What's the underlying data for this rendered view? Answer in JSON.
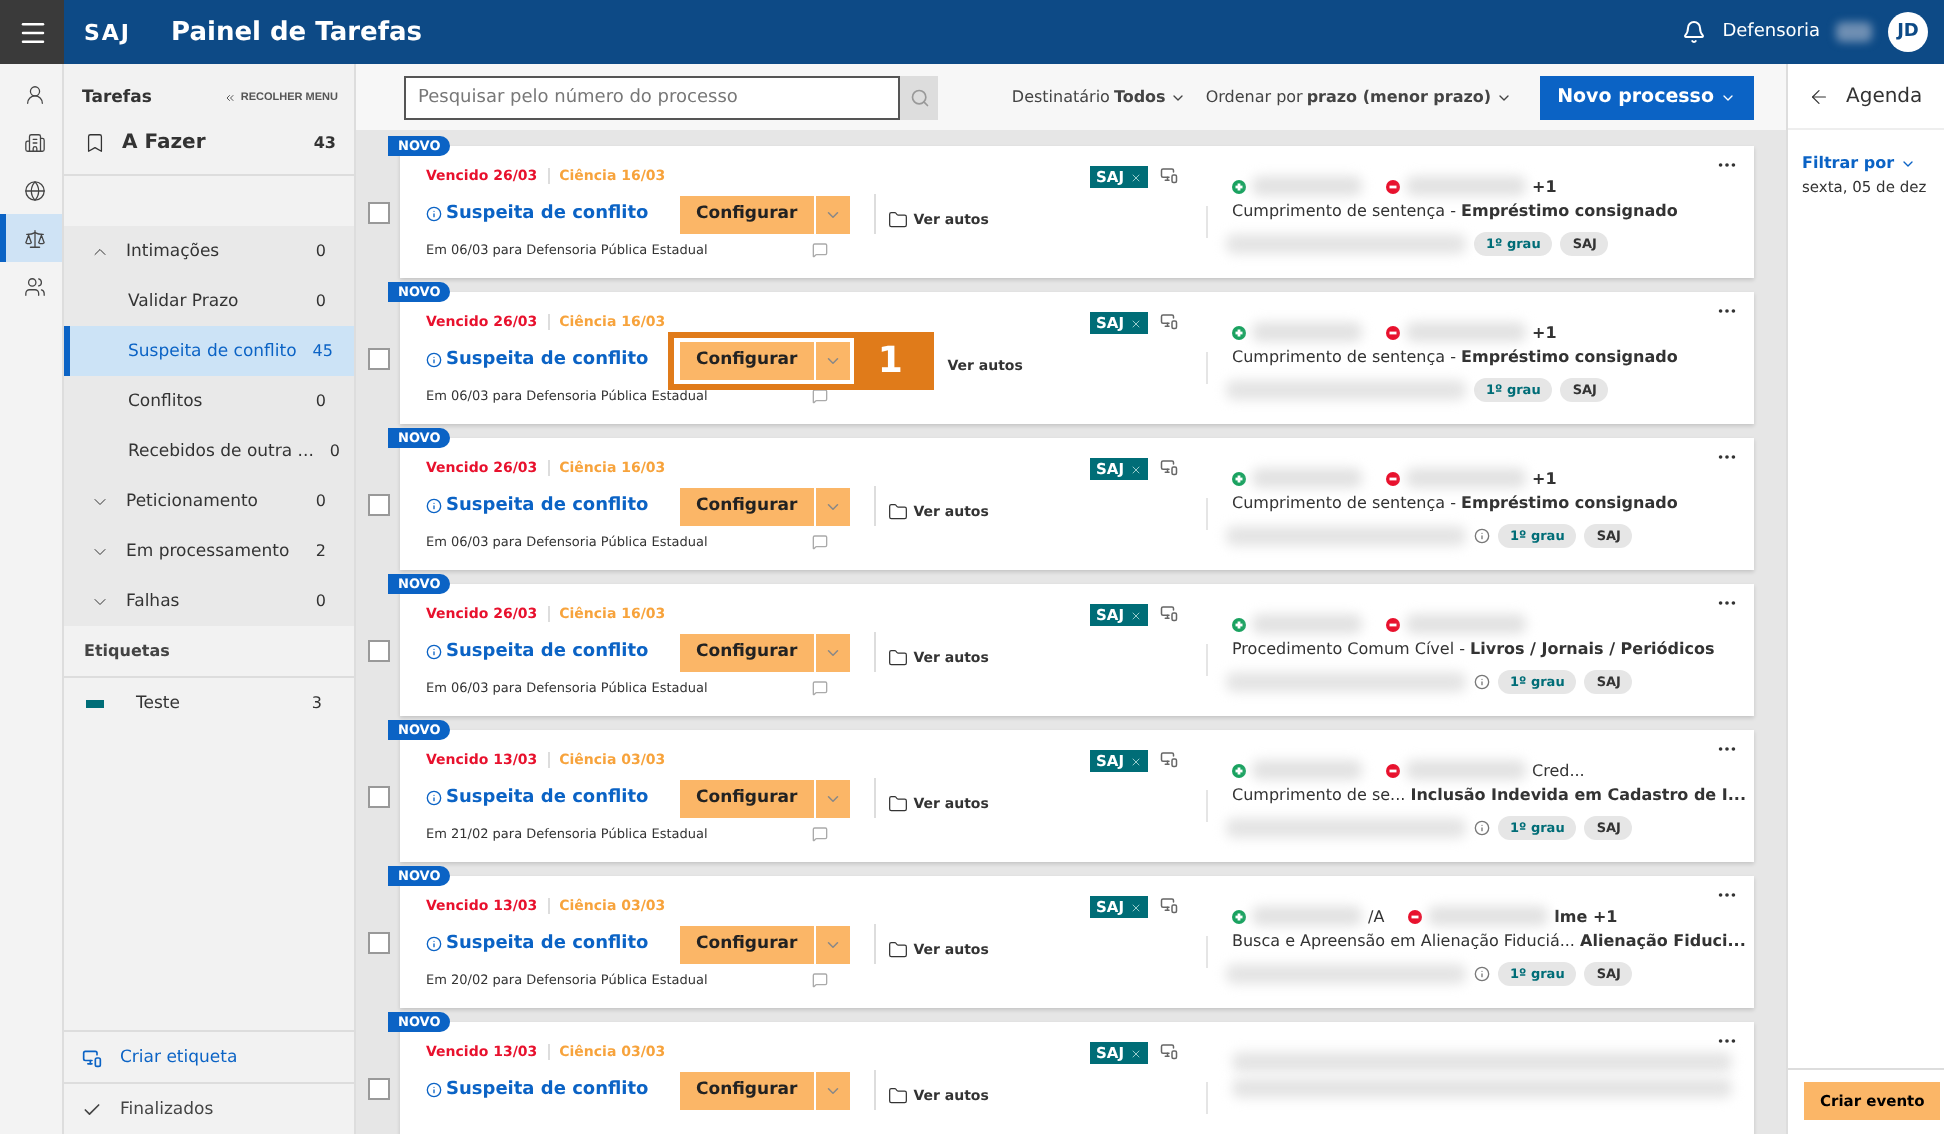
{
  "topbar": {
    "logo": "SAJ",
    "title": "Painel de Tarefas",
    "user": "Defensoria",
    "avatar": "JD"
  },
  "rail": [
    {
      "selected": false
    },
    {
      "selected": false
    },
    {
      "selected": false
    },
    {
      "selected": true
    },
    {
      "selected": false
    }
  ],
  "sidebar": {
    "title": "Tarefas",
    "collapse": "RECOLHER MENU",
    "todo": {
      "label": "A Fazer",
      "count": "43"
    },
    "groups": [
      {
        "label": "Intimações",
        "count": "0",
        "expanded": true,
        "children": [
          {
            "label": "Validar Prazo",
            "count": "0",
            "selected": false
          },
          {
            "label": "Suspeita de conflito",
            "count": "45",
            "selected": true
          },
          {
            "label": "Conflitos",
            "count": "0",
            "selected": false
          },
          {
            "label": "Recebidos de outra ...",
            "count": "0",
            "selected": false
          }
        ]
      },
      {
        "label": "Peticionamento",
        "count": "0",
        "expanded": false
      },
      {
        "label": "Em processamento",
        "count": "2",
        "expanded": false
      },
      {
        "label": "Falhas",
        "count": "0",
        "expanded": false
      }
    ],
    "labels_title": "Etiquetas",
    "labels": [
      {
        "label": "Teste",
        "count": "3",
        "color": "#006d77"
      }
    ],
    "create_label": "Criar etiqueta",
    "finished": "Finalizados"
  },
  "toolbar": {
    "search": {
      "placeholder": "Pesquisar pelo número do processo"
    },
    "recipient": {
      "label": "Destinatário",
      "value": "Todos"
    },
    "sort": {
      "label": "Ordenar por",
      "value": "prazo (menor prazo)"
    },
    "new_button": "Novo processo"
  },
  "cards": [
    {
      "badge": "NOVO",
      "due": "Vencido 26/03",
      "notice": "Ciência 16/03",
      "title": "Suspeita de conflito",
      "action": "Configurar",
      "open": "Ver autos",
      "footer": "Em 06/03 para Defensoria Pública Estadual",
      "system": "SAJ",
      "checked": false,
      "parties": [
        {
          "kind": "active"
        },
        {
          "kind": "passive",
          "tail": "+1"
        }
      ],
      "class": "Cumprimento de sentença -",
      "subject": "Empréstimo consignado",
      "info_icon": false,
      "tags": [
        "1º grau",
        "SAJ"
      ]
    },
    {
      "badge": "NOVO",
      "due": "Vencido 26/03",
      "notice": "Ciência 16/03",
      "title": "Suspeita de conflito",
      "action": "Configurar",
      "open": "Ver autos",
      "footer": "Em 06/03 para Defensoria Pública Estadual",
      "system": "SAJ",
      "callout": "1",
      "checked": false,
      "parties": [
        {
          "kind": "active"
        },
        {
          "kind": "passive",
          "tail": "+1"
        }
      ],
      "class": "Cumprimento de sentença -",
      "subject": "Empréstimo consignado",
      "info_icon": false,
      "tags": [
        "1º grau",
        "SAJ"
      ]
    },
    {
      "badge": "NOVO",
      "due": "Vencido 26/03",
      "notice": "Ciência 16/03",
      "title": "Suspeita de conflito",
      "action": "Configurar",
      "open": "Ver autos",
      "footer": "Em 06/03 para Defensoria Pública Estadual",
      "system": "SAJ",
      "checked": false,
      "parties": [
        {
          "kind": "active"
        },
        {
          "kind": "passive",
          "tail": "+1"
        }
      ],
      "class": "Cumprimento de sentença -",
      "subject": "Empréstimo consignado",
      "info_icon": true,
      "tags": [
        "1º grau",
        "SAJ"
      ]
    },
    {
      "badge": "NOVO",
      "due": "Vencido 26/03",
      "notice": "Ciência 16/03",
      "title": "Suspeita de conflito",
      "action": "Configurar",
      "open": "Ver autos",
      "footer": "Em 06/03 para Defensoria Pública Estadual",
      "system": "SAJ",
      "checked": false,
      "parties": [
        {
          "kind": "active"
        },
        {
          "kind": "passive"
        }
      ],
      "class": "Procedimento Comum Cível -",
      "subject": "Livros / Jornais / Periódicos",
      "info_icon": true,
      "tags": [
        "1º grau",
        "SAJ"
      ]
    },
    {
      "badge": "NOVO",
      "due": "Vencido 13/03",
      "notice": "Ciência 03/03",
      "title": "Suspeita de conflito",
      "action": "Configurar",
      "open": "Ver autos",
      "footer": "Em 21/02 para Defensoria Pública Estadual",
      "system": "SAJ",
      "checked": false,
      "parties": [
        {
          "kind": "active"
        },
        {
          "kind": "passive",
          "tail": "Cred..."
        }
      ],
      "class": "Cumprimento de se...",
      "subject": "Inclusão Indevida em Cadastro de I...",
      "info_icon": true,
      "tags": [
        "1º grau",
        "SAJ"
      ]
    },
    {
      "badge": "NOVO",
      "due": "Vencido 13/03",
      "notice": "Ciência 03/03",
      "title": "Suspeita de conflito",
      "action": "Configurar",
      "open": "Ver autos",
      "footer": "Em 20/02 para Defensoria Pública Estadual",
      "system": "SAJ",
      "checked": false,
      "parties": [
        {
          "kind": "active",
          "tail": "/A"
        },
        {
          "kind": "passive",
          "tail": "lme +1"
        }
      ],
      "class": "Busca e Apreensão em Alienação Fiduciá...",
      "subject": "Alienação Fiduci...",
      "info_icon": true,
      "tags": [
        "1º grau",
        "SAJ"
      ]
    },
    {
      "badge": "NOVO",
      "due": "Vencido 13/03",
      "notice": "Ciência 03/03",
      "title": "Suspeita de conflito",
      "action": "Configurar",
      "open": "Ver autos",
      "system": "SAJ",
      "checked": false
    }
  ],
  "agenda": {
    "title": "Agenda",
    "filter": "Filtrar por",
    "date": "sexta, 05 de dez",
    "create": "Criar evento"
  }
}
